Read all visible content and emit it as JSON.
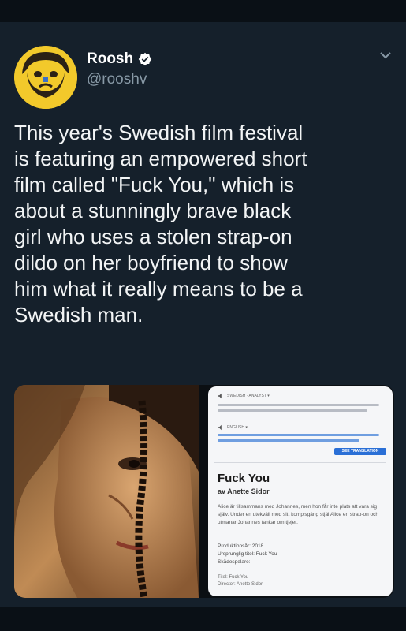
{
  "tweet": {
    "display_name": "Roosh",
    "handle": "@rooshv",
    "verified_icon": "verified-badge-icon",
    "text_lines": [
      "This year's Swedish film festival",
      "is featuring an empowered short",
      "film called \"Fuck You,\" which is",
      "about a stunningly brave black",
      "girl who uses a stolen strap-on",
      "dildo on her boyfriend to show",
      "him what it really means to be a",
      "Swedish man."
    ]
  },
  "card": {
    "title": "Fuck You",
    "author": "av Anette Sidor",
    "translate_label": "SEE TRANSLATION",
    "lang_tag_1": "SWEDISH · ANALYST ▾",
    "lang_tag_2": "ENGLISH ▾",
    "description": "Alice är tillsammans med Johannes, men hon får inte plats att vara sig själv. Under en utekväll med sitt kompisgäng stjäl Alice en strap-on och utmanar Johannes tankar om tjejer.",
    "meta": [
      "Produktionsår: 2018",
      "Ursprunglig titel: Fuck You",
      "Skådespelare:"
    ],
    "meta2": [
      "Titel: Fuck You",
      "Director: Anette Sidor"
    ]
  },
  "colors": {
    "background": "#15202b",
    "text": "#f2f4f5",
    "secondary_text": "#8899a6",
    "verified_blue": "#ffffff"
  }
}
